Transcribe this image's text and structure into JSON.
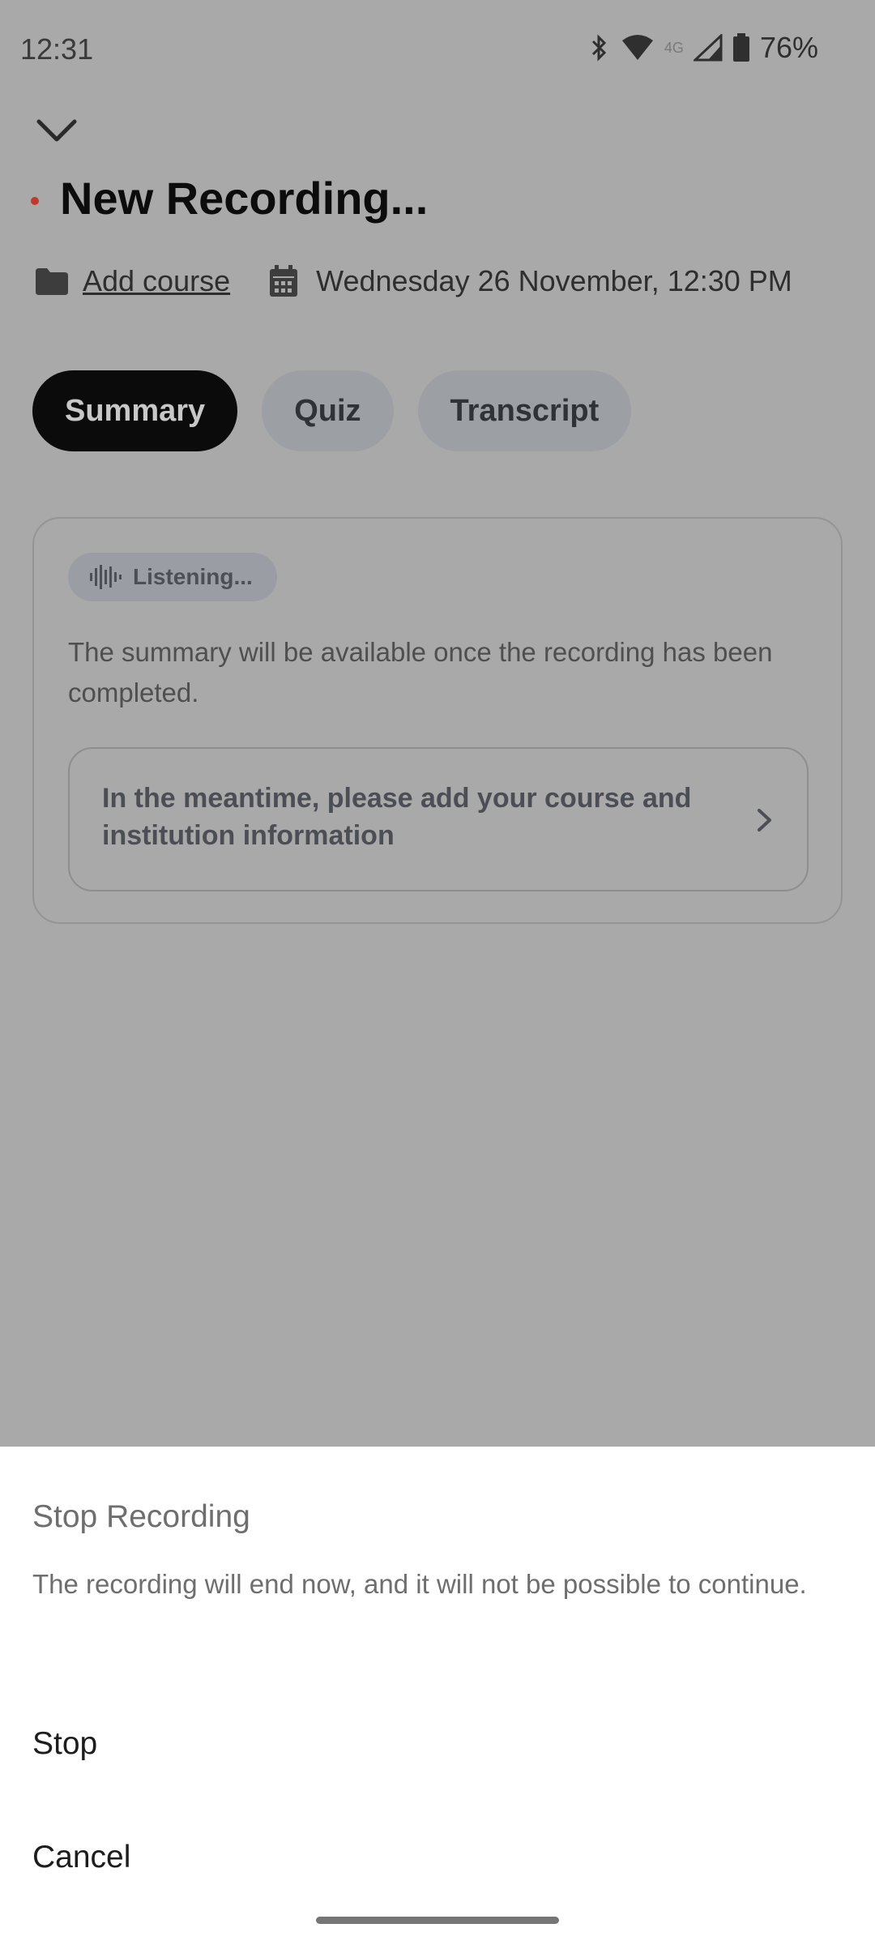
{
  "status_bar": {
    "time": "12:31",
    "network_label": "4G",
    "battery": "76%"
  },
  "recording": {
    "title": "New Recording...",
    "add_course": "Add course",
    "date": "Wednesday 26 November, 12:30 PM"
  },
  "tabs": [
    {
      "label": "Summary",
      "active": true
    },
    {
      "label": "Quiz",
      "active": false
    },
    {
      "label": "Transcript",
      "active": false
    }
  ],
  "summary_card": {
    "badge": "Listening...",
    "description": "The summary will be available once the recording has been completed.",
    "info": "In the meantime, please add your course and institution information"
  },
  "dialog": {
    "title": "Stop Recording",
    "message": "The recording will end now, and it will not be possible to continue.",
    "stop_label": "Stop",
    "cancel_label": "Cancel"
  },
  "colors": {
    "overlay": "#a9a9a9",
    "active_tab": "#0b0b0b",
    "recording_dot": "#c0392b",
    "sheet": "#ffffff"
  }
}
